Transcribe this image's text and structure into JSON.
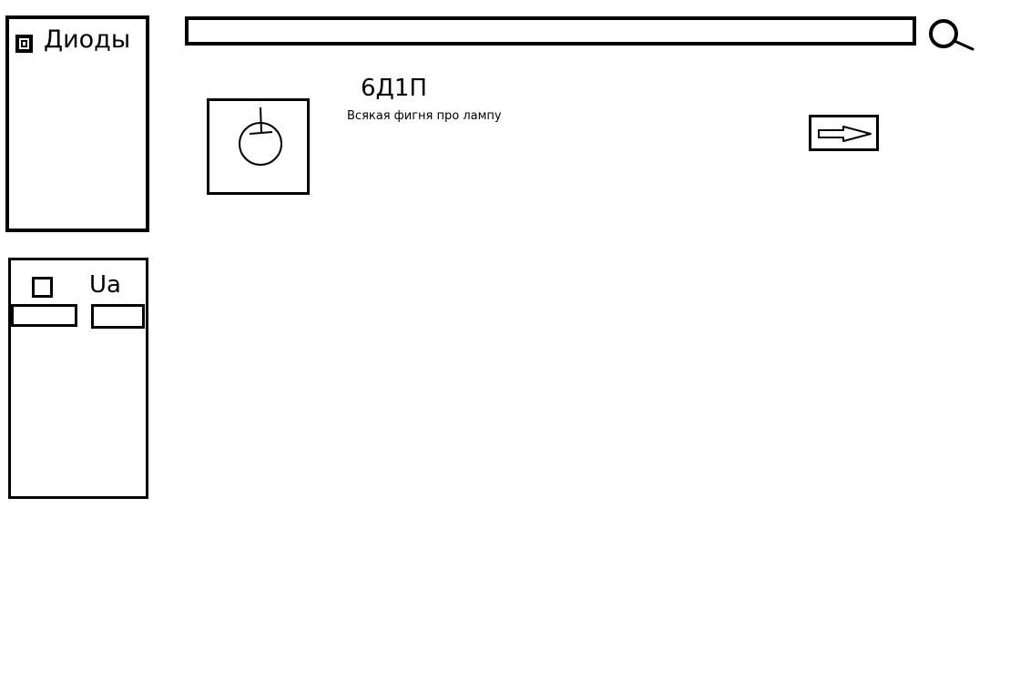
{
  "sidebar": {
    "category": {
      "label": "Диоды",
      "checked": true
    },
    "filter": {
      "label": "Ua",
      "checked": false,
      "min_value": "",
      "max_value": ""
    }
  },
  "search": {
    "value": "",
    "icon": "search-icon"
  },
  "results": [
    {
      "title": "6Д1П",
      "description": "Всякая фигня про лампу",
      "image_icon": "vacuum-tube-symbol-icon",
      "action_icon": "arrow-right-icon"
    }
  ]
}
